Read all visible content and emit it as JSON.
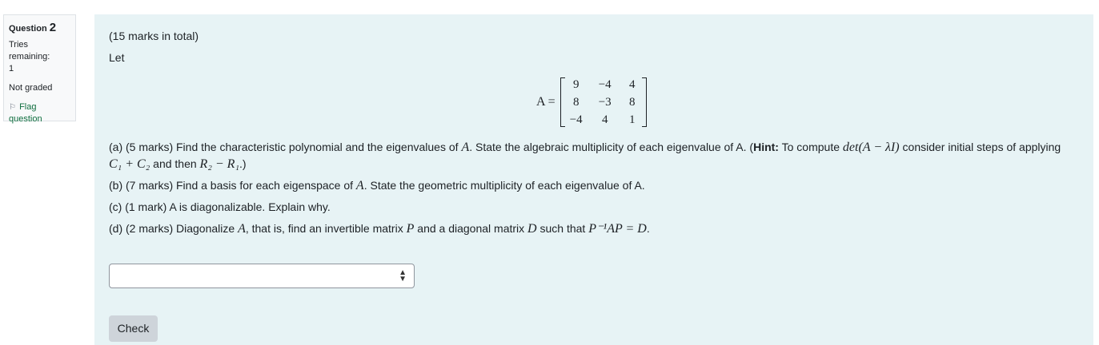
{
  "info": {
    "question_label": "Question",
    "question_number": "2",
    "tries_label": "Tries remaining:",
    "tries_value": "1",
    "state": "Not graded",
    "flag_label": "Flag question"
  },
  "question": {
    "marks": "(15 marks in total)",
    "let": "Let",
    "matrix_lhs": "A =",
    "matrix": [
      [
        "9",
        "−4",
        "4"
      ],
      [
        "8",
        "−3",
        "8"
      ],
      [
        "−4",
        "4",
        "1"
      ]
    ],
    "part_a": {
      "t1": "(a) (5 marks) Find the characteristic polynomial and the eigenvalues of",
      "m1": "A",
      "t2": ".  State the algebraic multiplicity of each eigenvalue of A.  (",
      "hint": "Hint:",
      "t3": " To compute",
      "m2": "det(A − λI)",
      "t4": " consider initial steps of applying",
      "m3": "C₁ + C₂",
      "t5": " and then",
      "m4": "R₂ − R₁",
      "t6": ".)"
    },
    "part_b": {
      "t1": "(b) (7 marks)  Find a basis for each eigenspace of",
      "m1": "A",
      "t2": ". State the geometric multiplicity of each eigenvalue of A."
    },
    "part_c": "(c) (1 mark) A is diagonalizable. Explain why.",
    "part_d": {
      "t1": "(d) (2 marks) Diagonalize",
      "m1": "A",
      "t2": ", that is, find an invertible matrix",
      "m2": "P",
      "t3": " and a diagonal matrix",
      "m3": "D",
      "t4": " such that",
      "m4": "P⁻¹AP = D",
      "t5": "."
    },
    "select_value": "",
    "check_label": "Check"
  }
}
